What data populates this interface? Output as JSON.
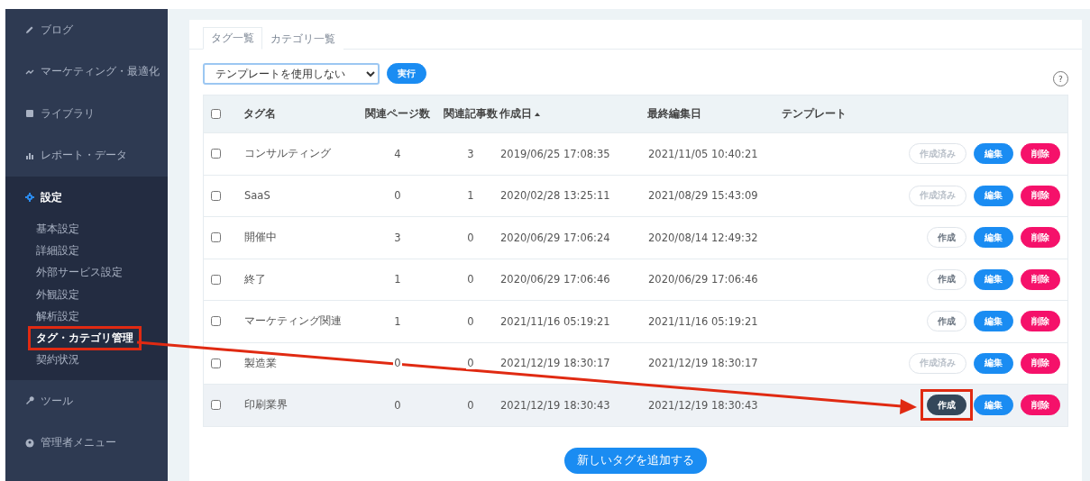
{
  "sidebar": {
    "items": [
      {
        "kind": "pencil",
        "label": "ブログ",
        "selected": false
      },
      {
        "kind": "trend",
        "label": "マーケティング・最適化",
        "selected": false
      },
      {
        "kind": "image",
        "label": "ライブラリ",
        "selected": false
      },
      {
        "kind": "chart",
        "label": "レポート・データ",
        "selected": false
      },
      {
        "kind": "gear",
        "label": "設定",
        "selected": true,
        "children": [
          {
            "label": "基本設定",
            "selected": false,
            "highlighted": false
          },
          {
            "label": "詳細設定",
            "selected": false,
            "highlighted": false
          },
          {
            "label": "外部サービス設定",
            "selected": false,
            "highlighted": false
          },
          {
            "label": "外観設定",
            "selected": false,
            "highlighted": false
          },
          {
            "label": "解析設定",
            "selected": false,
            "highlighted": false
          },
          {
            "label": "タグ・カテゴリ管理",
            "selected": true,
            "highlighted": true
          },
          {
            "label": "契約状況",
            "selected": false,
            "highlighted": false
          }
        ]
      },
      {
        "kind": "wrench",
        "label": "ツール",
        "selected": false
      },
      {
        "kind": "user",
        "label": "管理者メニュー",
        "selected": false
      }
    ]
  },
  "tabs": [
    {
      "label": "タグ一覧",
      "selected": true
    },
    {
      "label": "カテゴリ一覧",
      "selected": false
    }
  ],
  "template_select": {
    "value": "テンプレートを使用しない"
  },
  "run_button": "実行",
  "help": "?",
  "table": {
    "select_all": {
      "checked": false
    },
    "columns": [
      {
        "label": "タグ名",
        "sorted": false
      },
      {
        "label": "関連ページ数",
        "sorted": false
      },
      {
        "label": "関連記事数",
        "sorted": false
      },
      {
        "label": "作成日",
        "sorted": true
      },
      {
        "label": "最終編集日",
        "sorted": false
      },
      {
        "label": "テンプレート",
        "sorted": false
      }
    ],
    "rows": [
      {
        "checked": false,
        "hovered": false,
        "cells": [
          "コンサルティング",
          "4",
          "3",
          "2019/06/25 17:08:35",
          "2021/11/05 10:40:21"
        ],
        "create": {
          "label": "作成済み",
          "disabled": true,
          "active": false,
          "highlighted": false
        },
        "edit": "編集",
        "delete": "削除"
      },
      {
        "checked": false,
        "hovered": false,
        "cells": [
          "SaaS",
          "0",
          "1",
          "2020/02/28 13:25:11",
          "2021/08/29 15:43:09"
        ],
        "create": {
          "label": "作成済み",
          "disabled": true,
          "active": false,
          "highlighted": false
        },
        "edit": "編集",
        "delete": "削除"
      },
      {
        "checked": false,
        "hovered": false,
        "cells": [
          "開催中",
          "3",
          "0",
          "2020/06/29 17:06:24",
          "2020/08/14 12:49:32"
        ],
        "create": {
          "label": "作成",
          "disabled": false,
          "active": false,
          "highlighted": false
        },
        "edit": "編集",
        "delete": "削除"
      },
      {
        "checked": false,
        "hovered": false,
        "cells": [
          "終了",
          "1",
          "0",
          "2020/06/29 17:06:46",
          "2020/06/29 17:06:46"
        ],
        "create": {
          "label": "作成",
          "disabled": false,
          "active": false,
          "highlighted": false
        },
        "edit": "編集",
        "delete": "削除"
      },
      {
        "checked": false,
        "hovered": false,
        "cells": [
          "マーケティング関連",
          "1",
          "0",
          "2021/11/16 05:19:21",
          "2021/11/16 05:19:21"
        ],
        "create": {
          "label": "作成",
          "disabled": false,
          "active": false,
          "highlighted": false
        },
        "edit": "編集",
        "delete": "削除"
      },
      {
        "checked": false,
        "hovered": false,
        "cells": [
          "製造業",
          "0",
          "0",
          "2021/12/19 18:30:17",
          "2021/12/19 18:30:17"
        ],
        "create": {
          "label": "作成済み",
          "disabled": true,
          "active": false,
          "highlighted": false
        },
        "edit": "編集",
        "delete": "削除"
      },
      {
        "checked": false,
        "hovered": true,
        "cells": [
          "印刷業界",
          "0",
          "0",
          "2021/12/19 18:30:43",
          "2021/12/19 18:30:43"
        ],
        "create": {
          "label": "作成",
          "disabled": false,
          "active": true,
          "highlighted": true
        },
        "edit": "編集",
        "delete": "削除"
      }
    ]
  },
  "add_button": "新しいタグを追加する"
}
